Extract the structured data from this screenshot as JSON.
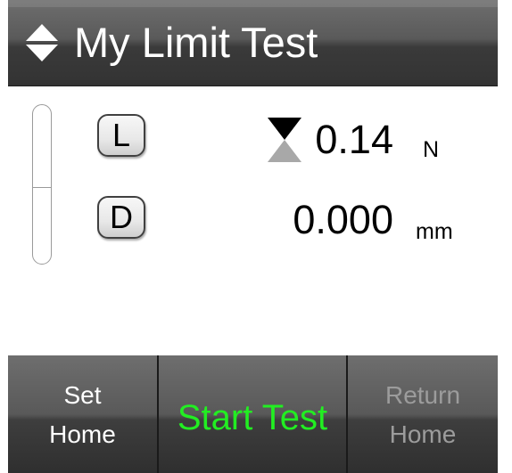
{
  "header": {
    "icon": "sort-up-down-icon",
    "title": "My Limit Test"
  },
  "readouts": {
    "load": {
      "button_label": "L",
      "indicator_icon": "hourglass-icon",
      "value": "0.14",
      "unit": "N"
    },
    "distance": {
      "button_label": "D",
      "value": "0.000",
      "unit": "mm"
    }
  },
  "bottom_bar": {
    "set_home": {
      "line1": "Set",
      "line2": "Home"
    },
    "start_test": {
      "label": "Start Test"
    },
    "return_home": {
      "line1": "Return",
      "line2": "Home",
      "enabled": false
    }
  },
  "colors": {
    "header_bg": "#4a4a4a",
    "start_test_text": "#22ee22",
    "disabled_text": "#9c9c9c",
    "content_bg": "#ffffff"
  }
}
